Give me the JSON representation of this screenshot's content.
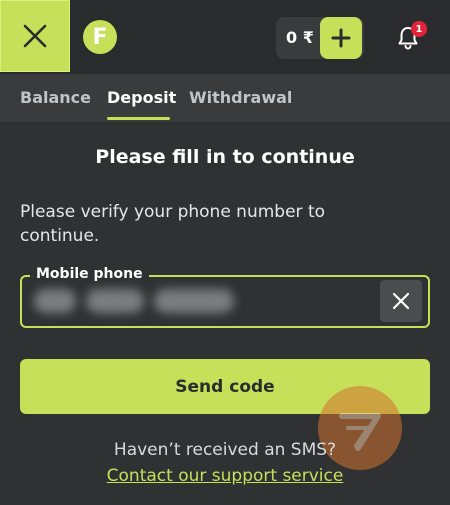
{
  "header": {
    "balance_amount": "0",
    "currency_symbol": "₹",
    "notification_count": "1",
    "logo_letter": "F"
  },
  "tabs": [
    {
      "label": "Balance"
    },
    {
      "label": "Deposit"
    },
    {
      "label": "Withdrawal"
    }
  ],
  "form": {
    "title": "Please fill in to continue",
    "instruction": "Please verify your phone number to continue.",
    "phone_label": "Mobile phone",
    "phone_value": "",
    "send_label": "Send code"
  },
  "footer": {
    "sms_question": "Haven’t received an SMS?",
    "support_link": "Contact our support service"
  },
  "colors": {
    "accent": "#c6e05a",
    "background": "#303132",
    "badge": "#e3233a"
  }
}
